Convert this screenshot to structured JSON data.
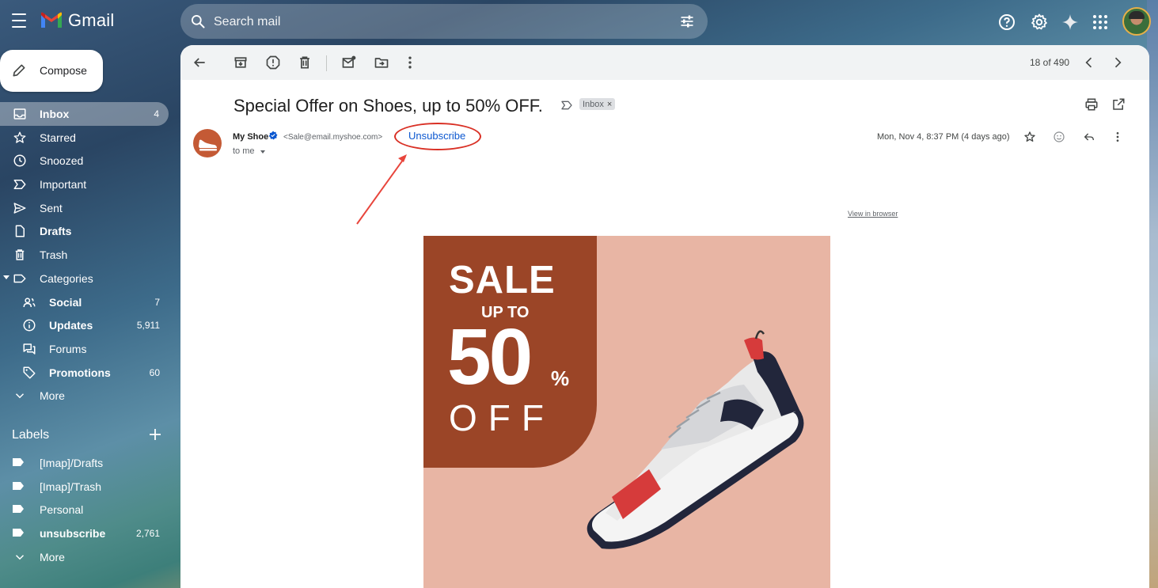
{
  "app": {
    "name": "Gmail"
  },
  "search": {
    "placeholder": "Search mail"
  },
  "compose": {
    "label": "Compose"
  },
  "nav": [
    {
      "label": "Inbox",
      "count": "4"
    },
    {
      "label": "Starred",
      "count": ""
    },
    {
      "label": "Snoozed",
      "count": ""
    },
    {
      "label": "Important",
      "count": ""
    },
    {
      "label": "Sent",
      "count": ""
    },
    {
      "label": "Drafts",
      "count": ""
    },
    {
      "label": "Trash",
      "count": ""
    },
    {
      "label": "Categories",
      "count": ""
    },
    {
      "label": "Social",
      "count": "7"
    },
    {
      "label": "Updates",
      "count": "5,911"
    },
    {
      "label": "Forums",
      "count": ""
    },
    {
      "label": "Promotions",
      "count": "60"
    },
    {
      "label": "More",
      "count": ""
    }
  ],
  "labels": {
    "heading": "Labels",
    "items": [
      {
        "label": "[Imap]/Drafts",
        "count": ""
      },
      {
        "label": "[Imap]/Trash",
        "count": ""
      },
      {
        "label": "Personal",
        "count": ""
      },
      {
        "label": "unsubscribe",
        "count": "2,761"
      },
      {
        "label": "More",
        "count": ""
      }
    ]
  },
  "toolbar": {
    "pager": "18 of 490"
  },
  "email": {
    "subject": "Special Offer on Shoes, up to 50% OFF.",
    "label_chip": "Inbox",
    "sender_name": "My Shoe",
    "sender_email": "<Sale@email.myshoe.com>",
    "unsubscribe": "Unsubscribe",
    "to": "to me",
    "date": "Mon, Nov 4, 8:37 PM (4 days ago)",
    "view_in_browser": "View in browser"
  },
  "banner": {
    "sale": "SALE",
    "up_to": "UP TO",
    "percent_value": "50",
    "percent_sign": "%",
    "off": "OFF"
  },
  "colors": {
    "accent_blue": "#0b57d0",
    "annotation_red": "#d93025",
    "banner_dark": "#9b4527",
    "banner_light": "#e8b5a4"
  }
}
